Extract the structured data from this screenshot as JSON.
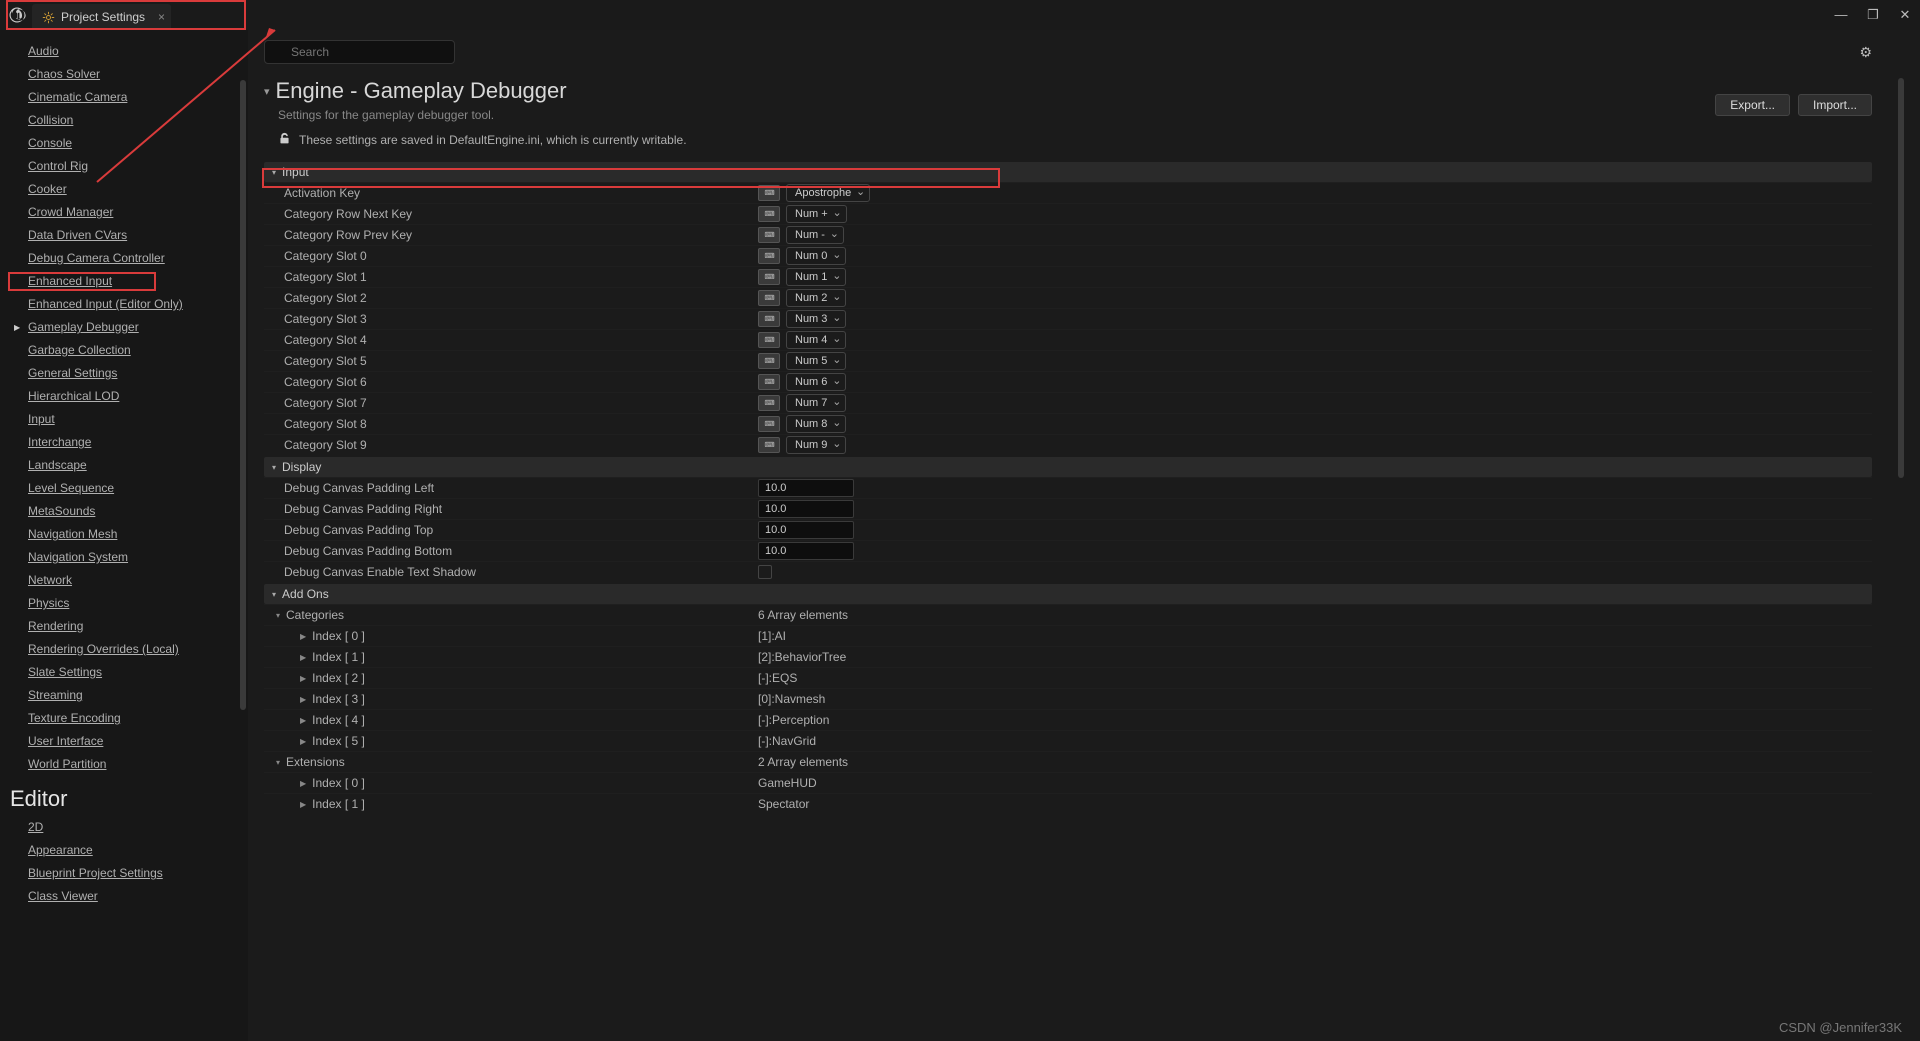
{
  "titlebar": {
    "tab_title": "Project Settings",
    "min": "—",
    "restore": "❐",
    "close": "✕"
  },
  "sidebar_items": [
    {
      "label": "Audio",
      "active": false
    },
    {
      "label": "Chaos Solver",
      "active": false
    },
    {
      "label": "Cinematic Camera",
      "active": false
    },
    {
      "label": "Collision",
      "active": false
    },
    {
      "label": "Console",
      "active": false
    },
    {
      "label": "Control Rig",
      "active": false
    },
    {
      "label": "Cooker",
      "active": false
    },
    {
      "label": "Crowd Manager",
      "active": false
    },
    {
      "label": "Data Driven CVars",
      "active": false
    },
    {
      "label": "Debug Camera Controller",
      "active": false
    },
    {
      "label": "Enhanced Input",
      "active": false
    },
    {
      "label": "Enhanced Input (Editor Only)",
      "active": false
    },
    {
      "label": "Gameplay Debugger",
      "active": true
    },
    {
      "label": "Garbage Collection",
      "active": false
    },
    {
      "label": "General Settings",
      "active": false
    },
    {
      "label": "Hierarchical LOD",
      "active": false
    },
    {
      "label": "Input",
      "active": false
    },
    {
      "label": "Interchange",
      "active": false
    },
    {
      "label": "Landscape",
      "active": false
    },
    {
      "label": "Level Sequence",
      "active": false
    },
    {
      "label": "MetaSounds",
      "active": false
    },
    {
      "label": "Navigation Mesh",
      "active": false
    },
    {
      "label": "Navigation System",
      "active": false
    },
    {
      "label": "Network",
      "active": false
    },
    {
      "label": "Physics",
      "active": false
    },
    {
      "label": "Rendering",
      "active": false
    },
    {
      "label": "Rendering Overrides (Local)",
      "active": false
    },
    {
      "label": "Slate Settings",
      "active": false
    },
    {
      "label": "Streaming",
      "active": false
    },
    {
      "label": "Texture Encoding",
      "active": false
    },
    {
      "label": "User Interface",
      "active": false
    },
    {
      "label": "World Partition",
      "active": false
    }
  ],
  "sidebar_heading": "Editor",
  "sidebar_editor_items": [
    {
      "label": "2D"
    },
    {
      "label": "Appearance"
    },
    {
      "label": "Blueprint Project Settings"
    },
    {
      "label": "Class Viewer"
    }
  ],
  "search": {
    "placeholder": "Search"
  },
  "page": {
    "title": "Engine - Gameplay Debugger",
    "subtitle": "Settings for the gameplay debugger tool.",
    "lock_text": "These settings are saved in DefaultEngine.ini, which is currently writable.",
    "export": "Export...",
    "import": "Import..."
  },
  "sections": {
    "input": {
      "title": "Input"
    },
    "display": {
      "title": "Display"
    },
    "addons": {
      "title": "Add Ons"
    }
  },
  "input_rows": [
    {
      "label": "Activation Key",
      "value": "Apostrophe"
    },
    {
      "label": "Category Row Next Key",
      "value": "Num +"
    },
    {
      "label": "Category Row Prev Key",
      "value": "Num -"
    },
    {
      "label": "Category Slot 0",
      "value": "Num 0"
    },
    {
      "label": "Category Slot 1",
      "value": "Num 1"
    },
    {
      "label": "Category Slot 2",
      "value": "Num 2"
    },
    {
      "label": "Category Slot 3",
      "value": "Num 3"
    },
    {
      "label": "Category Slot 4",
      "value": "Num 4"
    },
    {
      "label": "Category Slot 5",
      "value": "Num 5"
    },
    {
      "label": "Category Slot 6",
      "value": "Num 6"
    },
    {
      "label": "Category Slot 7",
      "value": "Num 7"
    },
    {
      "label": "Category Slot 8",
      "value": "Num 8"
    },
    {
      "label": "Category Slot 9",
      "value": "Num 9"
    }
  ],
  "display_rows": [
    {
      "label": "Debug Canvas Padding Left",
      "value": "10.0"
    },
    {
      "label": "Debug Canvas Padding Right",
      "value": "10.0"
    },
    {
      "label": "Debug Canvas Padding Top",
      "value": "10.0"
    },
    {
      "label": "Debug Canvas Padding Bottom",
      "value": "10.0"
    }
  ],
  "display_shadow": {
    "label": "Debug Canvas Enable Text Shadow"
  },
  "categories": {
    "label": "Categories",
    "count": "6 Array elements",
    "items": [
      {
        "label": "Index [ 0 ]",
        "value": "[1]:AI"
      },
      {
        "label": "Index [ 1 ]",
        "value": "[2]:BehaviorTree"
      },
      {
        "label": "Index [ 2 ]",
        "value": "[-]:EQS"
      },
      {
        "label": "Index [ 3 ]",
        "value": "[0]:Navmesh"
      },
      {
        "label": "Index [ 4 ]",
        "value": "[-]:Perception"
      },
      {
        "label": "Index [ 5 ]",
        "value": "[-]:NavGrid"
      }
    ]
  },
  "extensions": {
    "label": "Extensions",
    "count": "2 Array elements",
    "items": [
      {
        "label": "Index [ 0 ]",
        "value": "GameHUD"
      },
      {
        "label": "Index [ 1 ]",
        "value": "Spectator"
      }
    ]
  },
  "watermark": "CSDN @Jennifer33K"
}
